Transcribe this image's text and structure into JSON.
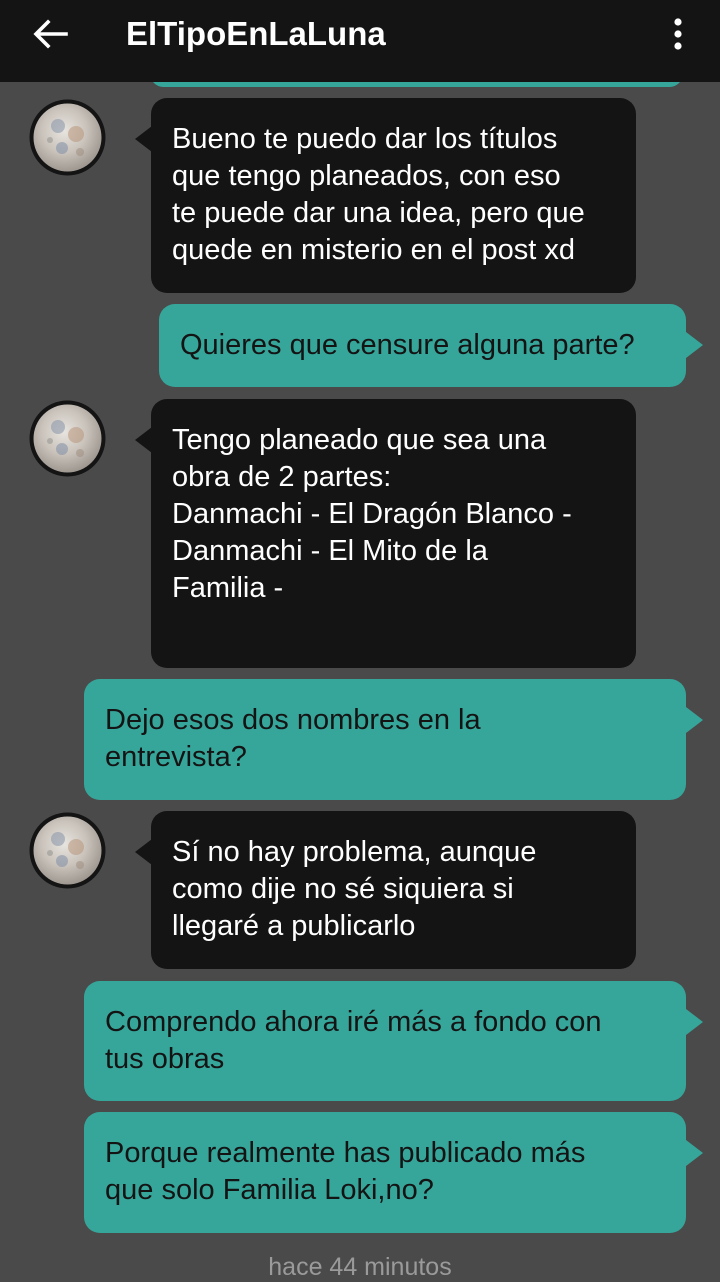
{
  "header": {
    "title": "ElTipoEnLaLuna",
    "back_icon": "arrow-left-icon",
    "menu_icon": "more-vertical-icon"
  },
  "colors": {
    "background": "#4a4a4a",
    "topbar": "#141414",
    "incoming_bubble": "#141414",
    "outgoing_bubble": "#36a69b"
  },
  "messages": [
    {
      "sender": "other",
      "text": "Bueno te puedo dar los títulos\nque tengo planeados, con eso\nte puede dar una idea, pero que\nquede en misterio en el post xd"
    },
    {
      "sender": "me",
      "text": "Quieres que censure alguna parte?"
    },
    {
      "sender": "other",
      "text": "Tengo planeado que sea una\nobra de 2 partes:\nDanmachi - El Dragón Blanco -\nDanmachi - El Mito de la\nFamilia -"
    },
    {
      "sender": "me",
      "text": "Dejo esos dos nombres en la\nentrevista?"
    },
    {
      "sender": "other",
      "text": "Sí no hay problema, aunque\ncomo dije no sé siquiera si\nllegaré a publicarlo"
    },
    {
      "sender": "me",
      "text": "Comprendo ahora iré más a fondo con\ntus obras"
    },
    {
      "sender": "me",
      "text": "Porque realmente has publicado más\nque solo Familia Loki,no?"
    }
  ],
  "timestamp": "hace 44 minutos"
}
